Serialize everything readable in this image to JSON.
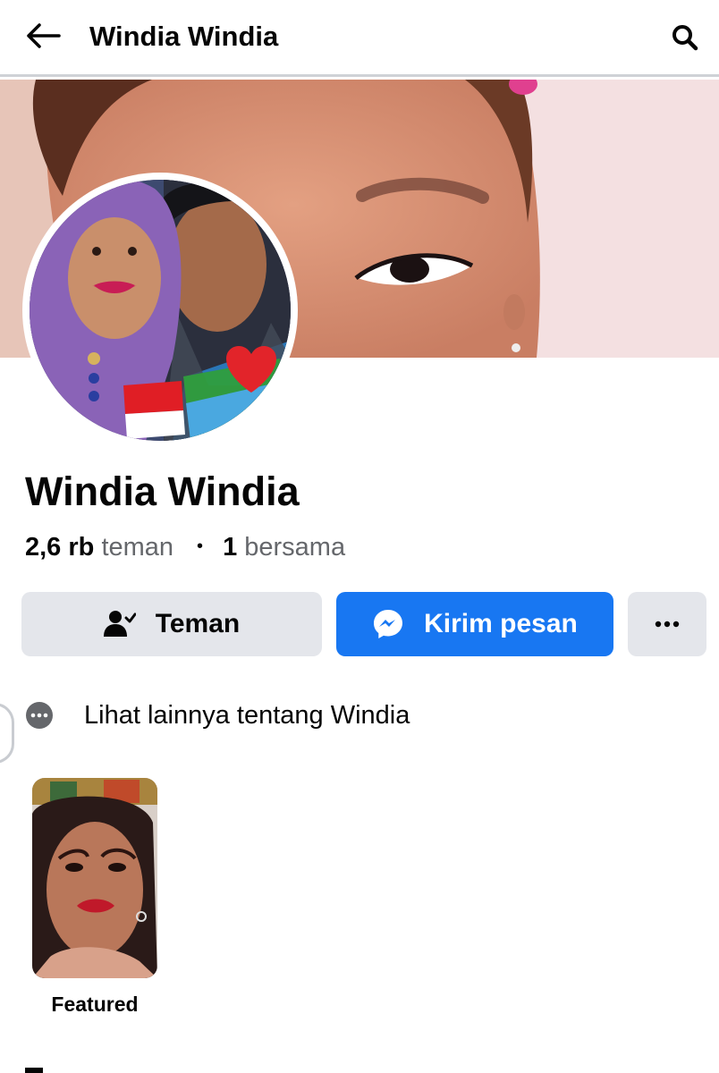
{
  "header": {
    "title": "Windia Windia",
    "back_icon": "arrow-left-icon",
    "search_icon": "search-icon"
  },
  "profile": {
    "name": "Windia Windia",
    "friends_count": "2,6 rb",
    "friends_label": "teman",
    "separator": "•",
    "mutual_count": "1",
    "mutual_label": "bersama"
  },
  "actions": {
    "friend_label": "Teman",
    "friend_icon": "person-check-icon",
    "message_label": "Kirim pesan",
    "message_icon": "messenger-icon",
    "more_icon": "more-horizontal-icon"
  },
  "about": {
    "more_label": "Lihat lainnya tentang Windia",
    "more_icon": "more-circle-icon"
  },
  "featured": {
    "label": "Featured"
  },
  "colors": {
    "accent": "#1877f2",
    "button_gray": "#e4e6eb",
    "text_primary": "#050505",
    "text_secondary": "#65676b"
  }
}
